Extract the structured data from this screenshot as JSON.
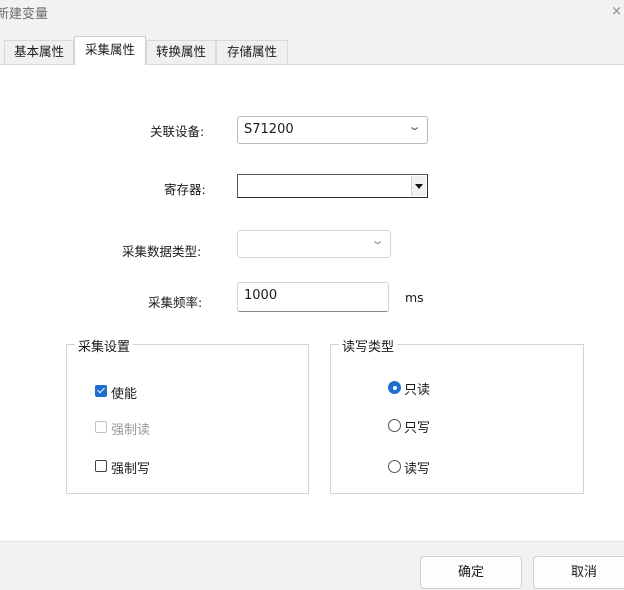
{
  "window": {
    "title": "新建变量",
    "close_glyph": "×"
  },
  "tabs": [
    {
      "label": "基本属性",
      "active": false
    },
    {
      "label": "采集属性",
      "active": true
    },
    {
      "label": "转换属性",
      "active": false
    },
    {
      "label": "存储属性",
      "active": false
    }
  ],
  "form": {
    "device": {
      "label": "关联设备:",
      "value": "S71200"
    },
    "register": {
      "label": "寄存器:",
      "value": ""
    },
    "data_type": {
      "label": "采集数据类型:",
      "value": ""
    },
    "frequency": {
      "label": "采集频率:",
      "value": "1000",
      "unit": "ms"
    }
  },
  "collect_settings": {
    "title": "采集设置",
    "options": [
      {
        "label": "使能",
        "checked": true,
        "enabled": true
      },
      {
        "label": "强制读",
        "checked": false,
        "enabled": false
      },
      {
        "label": "强制写",
        "checked": false,
        "enabled": true
      }
    ]
  },
  "rw_type": {
    "title": "读写类型",
    "options": [
      {
        "label": "只读",
        "selected": true
      },
      {
        "label": "只写",
        "selected": false
      },
      {
        "label": "读写",
        "selected": false
      }
    ]
  },
  "footer": {
    "ok_label": "确定",
    "cancel_label": "取消"
  },
  "colors": {
    "accent": "#1f6fd0",
    "chrome": "#f2f2f2"
  }
}
